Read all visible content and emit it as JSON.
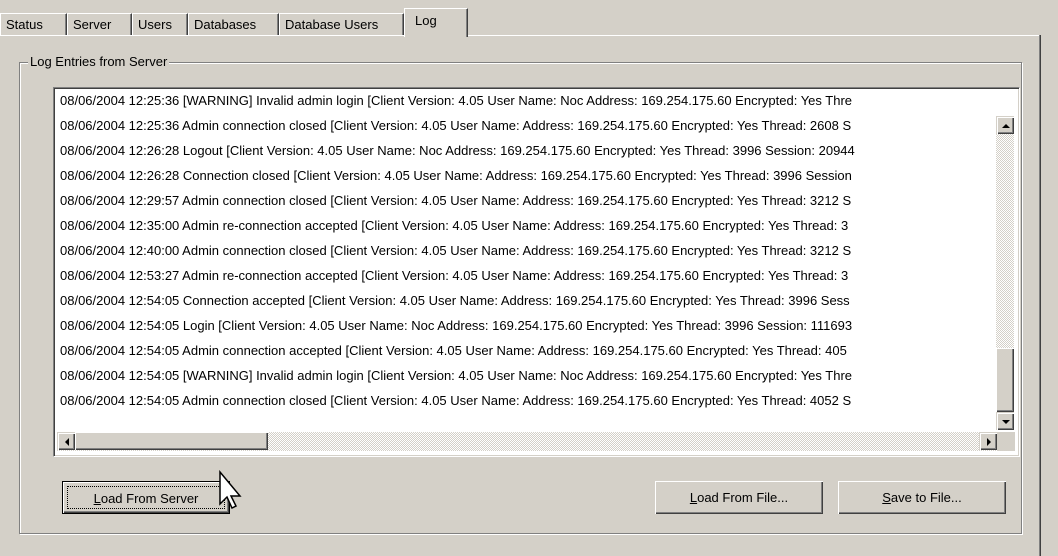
{
  "tabs": [
    {
      "label": "Status"
    },
    {
      "label": "Server"
    },
    {
      "label": "Users"
    },
    {
      "label": "Databases"
    },
    {
      "label": "Database Users"
    },
    {
      "label": "Log"
    }
  ],
  "group": {
    "title": "Log Entries from Server"
  },
  "log_entries": [
    "08/06/2004 12:25:36 [WARNING] Invalid admin login [Client Version: 4.05 User Name: Noc Address: 169.254.175.60 Encrypted: Yes Thre",
    "08/06/2004 12:25:36 Admin connection closed [Client Version: 4.05 User Name:  Address: 169.254.175.60 Encrypted: Yes Thread: 2608 S",
    "08/06/2004 12:26:28 Logout [Client Version: 4.05 User Name: Noc Address: 169.254.175.60 Encrypted: Yes Thread: 3996 Session: 20944",
    "08/06/2004 12:26:28 Connection closed [Client Version: 4.05 User Name:  Address: 169.254.175.60 Encrypted: Yes Thread: 3996 Session",
    "08/06/2004 12:29:57 Admin connection closed [Client Version: 4.05 User Name:  Address: 169.254.175.60 Encrypted: Yes Thread: 3212 S",
    "08/06/2004 12:35:00 Admin re-connection accepted [Client Version: 4.05 User Name:  Address: 169.254.175.60 Encrypted: Yes Thread: 3",
    "08/06/2004 12:40:00 Admin connection closed [Client Version: 4.05 User Name:  Address: 169.254.175.60 Encrypted: Yes Thread: 3212 S",
    "08/06/2004 12:53:27 Admin re-connection accepted [Client Version: 4.05 User Name:  Address: 169.254.175.60 Encrypted: Yes Thread: 3",
    "08/06/2004 12:54:05 Connection accepted [Client Version: 4.05 User Name:  Address: 169.254.175.60 Encrypted: Yes Thread: 3996 Sess",
    "08/06/2004 12:54:05 Login [Client Version: 4.05 User Name: Noc Address: 169.254.175.60 Encrypted: Yes Thread: 3996 Session: 111693",
    "08/06/2004 12:54:05 Admin connection accepted [Client Version: 4.05 User Name:  Address: 169.254.175.60 Encrypted: Yes Thread: 405",
    "08/06/2004 12:54:05 [WARNING] Invalid admin login [Client Version: 4.05 User Name: Noc Address: 169.254.175.60 Encrypted: Yes Thre",
    "08/06/2004 12:54:05 Admin connection closed [Client Version: 4.05 User Name:  Address: 169.254.175.60 Encrypted: Yes Thread: 4052 S"
  ],
  "buttons": {
    "load_server": {
      "mnemonic": "L",
      "rest": "oad From Server"
    },
    "load_file": {
      "mnemonic": "L",
      "rest": "oad From File..."
    },
    "save_file": {
      "mnemonic": "S",
      "rest": "ave to File..."
    }
  },
  "icons": {
    "scroll_up": "arrow-up-icon",
    "scroll_down": "arrow-down-icon",
    "scroll_left": "arrow-left-icon",
    "scroll_right": "arrow-right-icon",
    "cursor": "mouse-pointer-icon"
  },
  "colors": {
    "window": "#d4d0c8",
    "list_bg": "#ffffff"
  }
}
